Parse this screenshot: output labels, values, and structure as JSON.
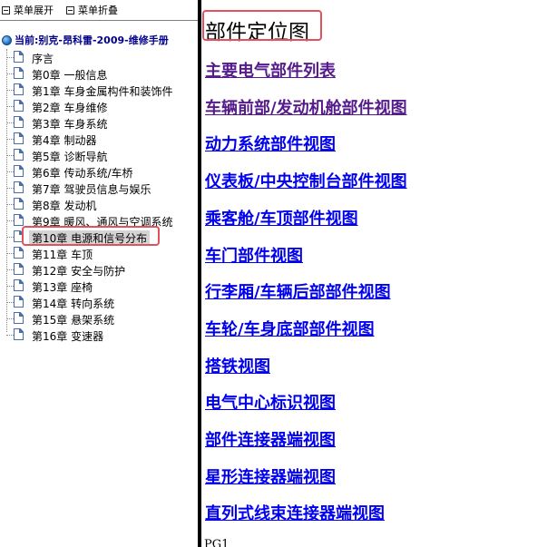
{
  "menu": {
    "expand_label": "菜单展开",
    "collapse_label": "菜单折叠"
  },
  "root": {
    "label": "当前:别克-昂科雷-2009-维修手册"
  },
  "tree": {
    "items": [
      {
        "label": "序言"
      },
      {
        "label": "第0章 一般信息"
      },
      {
        "label": "第1章 车身金属构件和装饰件"
      },
      {
        "label": "第2章 车身维修"
      },
      {
        "label": "第3章 车身系统"
      },
      {
        "label": "第4章 制动器"
      },
      {
        "label": "第5章 诊断导航"
      },
      {
        "label": "第6章 传动系统/车桥"
      },
      {
        "label": "第7章 驾驶员信息与娱乐"
      },
      {
        "label": "第8章 发动机"
      },
      {
        "label": "第9章 暖风、通风与空调系统"
      },
      {
        "label": "第10章 电源和信号分布",
        "selected": true
      },
      {
        "label": "第11章 车顶"
      },
      {
        "label": "第12章 安全与防护"
      },
      {
        "label": "第13章 座椅"
      },
      {
        "label": "第14章 转向系统"
      },
      {
        "label": "第15章 悬架系统"
      },
      {
        "label": "第16章 变速器"
      }
    ]
  },
  "content": {
    "title": "部件定位图",
    "links": [
      {
        "label": "主要电气部件列表",
        "visited": true
      },
      {
        "label": "车辆前部/发动机舱部件视图",
        "visited": true
      },
      {
        "label": "动力系统部件视图"
      },
      {
        "label": "仪表板/中央控制台部件视图"
      },
      {
        "label": "乘客舱/车顶部件视图"
      },
      {
        "label": "车门部件视图"
      },
      {
        "label": "行李厢/车辆后部部件视图"
      },
      {
        "label": "车轮/车身底部部件视图"
      },
      {
        "label": "搭铁视图"
      },
      {
        "label": "电气中心标识视图"
      },
      {
        "label": "部件连接器端视图"
      },
      {
        "label": "星形连接器端视图"
      },
      {
        "label": "直列式线束连接器端视图"
      }
    ],
    "footer": "PG1"
  },
  "colors": {
    "highlight_border": "#e0535e",
    "link": "#0000ee",
    "visited_link": "#551a8b",
    "selected_bg": "#d4d4d4"
  }
}
